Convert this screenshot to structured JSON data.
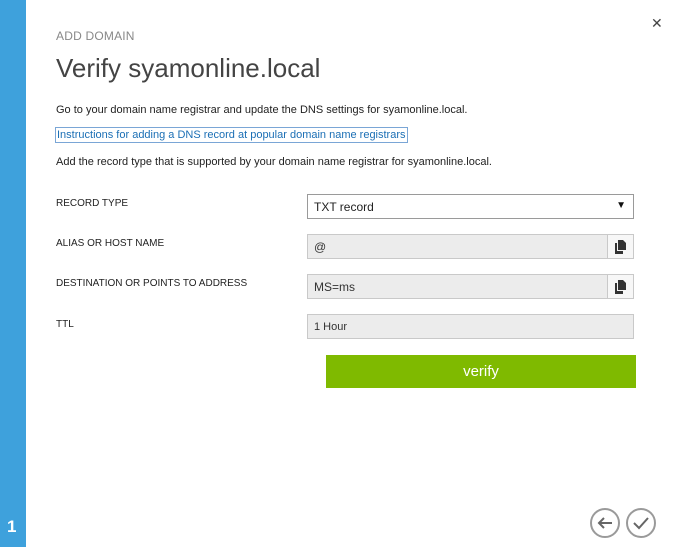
{
  "dialog": {
    "eyebrow": "ADD DOMAIN",
    "title": "Verify syamonline.local",
    "step": "1",
    "close_icon": "close-icon"
  },
  "instructions": {
    "line1": "Go to your domain name registrar and update the DNS settings for syamonline.local.",
    "link": "Instructions for adding a DNS record at popular domain name registrars",
    "line2": "Add the record type that is supported by your domain name registrar for syamonline.local."
  },
  "form": {
    "record_type": {
      "label": "RECORD TYPE",
      "value": "TXT record"
    },
    "alias": {
      "label": "ALIAS OR HOST NAME",
      "value": "@"
    },
    "destination": {
      "label": "DESTINATION OR POINTS TO ADDRESS",
      "value": "MS=ms"
    },
    "ttl": {
      "label": "TTL",
      "value": "1 Hour"
    }
  },
  "actions": {
    "verify_label": "verify"
  },
  "colors": {
    "sidebar": "#3ea1dc",
    "verify": "#7fba00",
    "link": "#1b6fb5"
  }
}
